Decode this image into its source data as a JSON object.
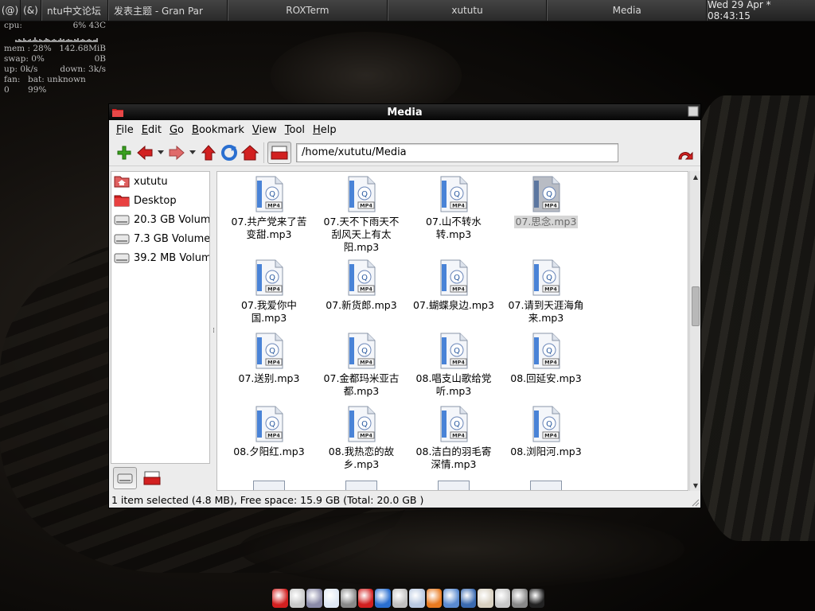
{
  "top_panel": {
    "workspaces": [
      "(@)",
      "(&)"
    ],
    "tasks": [
      "ntu中文论坛",
      "发表主题 - Gran Par",
      "ROXTerm",
      "xututu",
      "Media"
    ],
    "clock": "Wed 29 Apr * 08:43:15"
  },
  "conky": {
    "cpu_label": "cpu:",
    "cpu_value": "6% 43C",
    "mem_label": "mem : 28%",
    "mem_value": "142.68MiB",
    "swap_label": "swap: 0%",
    "swap_value": "0B",
    "up_label": "up: 0k/s",
    "down_label": "down: 3k/s",
    "fan_label": "fan: 0",
    "bat_label": "bat: unknown 99%"
  },
  "window": {
    "title": "Media",
    "menu": [
      "File",
      "Edit",
      "Go",
      "Bookmark",
      "View",
      "Tool",
      "Help"
    ],
    "location": "/home/xututu/Media",
    "sidebar": [
      {
        "label": "xututu",
        "icon": "home-folder-icon"
      },
      {
        "label": "Desktop",
        "icon": "desktop-folder-icon"
      },
      {
        "label": "20.3 GB Volume",
        "icon": "drive-icon"
      },
      {
        "label": "7.3 GB Volume",
        "icon": "drive-icon"
      },
      {
        "label": "39.2 MB Volume",
        "icon": "drive-icon"
      }
    ],
    "files": [
      {
        "name": "07.共产党来了苦变甜.mp3",
        "l1": "07.共产党来了苦",
        "l2": "变甜.mp3",
        "l3": ""
      },
      {
        "name": "07.天不下雨天不刮风天上有太阳.mp3",
        "l1": "07.天不下雨天不",
        "l2": "刮风天上有太",
        "l3": "阳.mp3"
      },
      {
        "name": "07.山不转水转.mp3",
        "l1": "07.山不转水",
        "l2": "转.mp3",
        "l3": ""
      },
      {
        "name": "07.思念.mp3",
        "l1": "07.思念.mp3",
        "l2": "",
        "l3": ""
      },
      {
        "name": "07.我爱你中国.mp3",
        "l1": "07.我爱你中",
        "l2": "国.mp3",
        "l3": ""
      },
      {
        "name": "07.新货郎.mp3",
        "l1": "07.新货郎.mp3",
        "l2": "",
        "l3": ""
      },
      {
        "name": "07.蝴蝶泉边.mp3",
        "l1": "07.蝴蝶泉边.mp3",
        "l2": "",
        "l3": ""
      },
      {
        "name": "07.请到天涯海角来.mp3",
        "l1": "07.请到天涯海角",
        "l2": "来.mp3",
        "l3": ""
      },
      {
        "name": "07.送别.mp3",
        "l1": "07.送别.mp3",
        "l2": "",
        "l3": ""
      },
      {
        "name": "07.金都玛米亚古都.mp3",
        "l1": "07.金都玛米亚古",
        "l2": "都.mp3",
        "l3": ""
      },
      {
        "name": "08.唱支山歌给党听.mp3",
        "l1": "08.唱支山歌给党",
        "l2": "听.mp3",
        "l3": ""
      },
      {
        "name": "08.回延安.mp3",
        "l1": "08.回延安.mp3",
        "l2": "",
        "l3": ""
      },
      {
        "name": "08.夕阳红.mp3",
        "l1": "08.夕阳红.mp3",
        "l2": "",
        "l3": ""
      },
      {
        "name": "08.我热恋的故乡.mp3",
        "l1": "08.我热恋的故",
        "l2": "乡.mp3",
        "l3": ""
      },
      {
        "name": "08.洁白的羽毛寄深情.mp3",
        "l1": "08.洁白的羽毛寄",
        "l2": "深情.mp3",
        "l3": ""
      },
      {
        "name": "08.浏阳河.mp3",
        "l1": "08.浏阳河.mp3",
        "l2": "",
        "l3": ""
      }
    ],
    "file_icon_badge": "MP4",
    "selected_index": 3,
    "status": "1 item selected (4.8 MB), Free space: 15.9 GB (Total: 20.0 GB )"
  },
  "colors": {
    "accent_red": "#d22020",
    "green": "#3aa01e",
    "blue": "#2a6fd0",
    "selection": "#d6d6d6"
  },
  "icons": {
    "toolbar": [
      "new-tab-icon",
      "back-arrow-icon",
      "dropdown-icon",
      "forward-arrow-icon",
      "dropdown-icon",
      "up-arrow-icon",
      "reload-icon",
      "home-icon",
      "side-pane-icon"
    ],
    "go": "go-icon"
  },
  "dock_icons": [
    "folder-icon",
    "text-editor-icon",
    "system-icon",
    "browser-icon",
    "media-icon",
    "opera-icon",
    "music-icon",
    "cd-icon",
    "globe-icon",
    "firefox-icon",
    "chat-icon",
    "qq-icon",
    "book-icon",
    "disk-icon",
    "joystick-icon",
    "terminal-icon"
  ]
}
